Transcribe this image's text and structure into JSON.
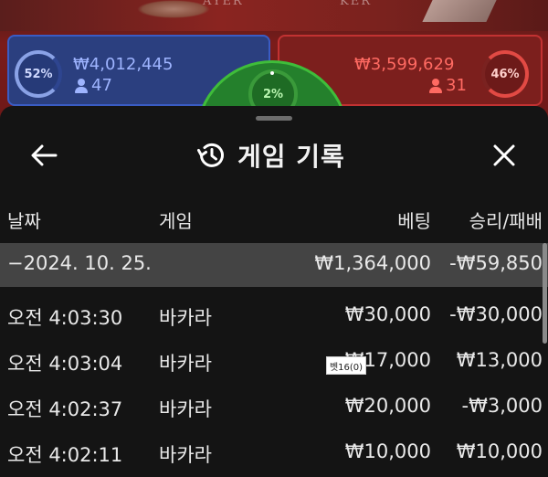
{
  "background": {
    "player_label": "AYER",
    "banker_label": "KER",
    "player": {
      "percent": "52%",
      "amount": "₩4,012,445",
      "count": "47"
    },
    "banker": {
      "percent": "46%",
      "amount": "₩3,599,629",
      "count": "31"
    },
    "tie": {
      "percent": "2%"
    },
    "colors": {
      "player": "#2b3f7f",
      "banker": "#7c1f1d",
      "tie": "#24802c"
    }
  },
  "modal": {
    "title": "게임 기록",
    "icons": {
      "back": "arrow-left-icon",
      "history": "history-clock-icon",
      "close": "close-icon"
    },
    "columns": {
      "date": "날짜",
      "game": "게임",
      "bet": "베팅",
      "result": "승리/패배"
    },
    "summary": {
      "date": "−2024. 10. 25.",
      "bet": "₩1,364,000",
      "result": "-₩59,850"
    },
    "rows": [
      {
        "time": "오전 4:03:30",
        "game": "바카라",
        "bet": "₩30,000",
        "result": "-₩30,000"
      },
      {
        "time": "오전 4:03:04",
        "game": "바카라",
        "bet": "₩17,000",
        "result": "₩13,000"
      },
      {
        "time": "오전 4:02:37",
        "game": "바카라",
        "bet": "₩20,000",
        "result": "-₩3,000"
      },
      {
        "time": "오전 4:02:11",
        "game": "바카라",
        "bet": "₩10,000",
        "result": "₩10,000"
      }
    ],
    "tooltip": "벳16(0)"
  }
}
